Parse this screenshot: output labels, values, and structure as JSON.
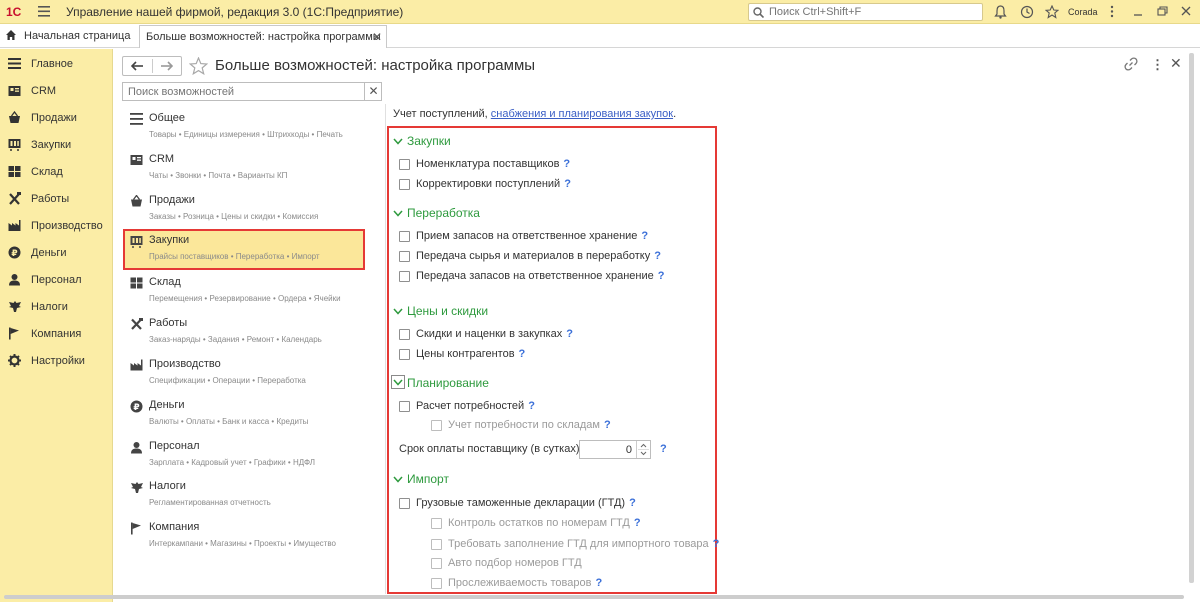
{
  "app": {
    "logo": "1С",
    "title": "Управление нашей фирмой, редакция 3.0  (1С:Предприятие)",
    "search_placeholder": "Поиск Ctrl+Shift+F",
    "user": "Corada"
  },
  "tabs": {
    "home": "Начальная страница",
    "active": "Больше возможностей: настройка программы"
  },
  "sidebar": {
    "items": [
      {
        "label": "Главное",
        "icon": "menu-lines-icon"
      },
      {
        "label": "CRM",
        "icon": "crm-icon"
      },
      {
        "label": "Продажи",
        "icon": "basket-icon"
      },
      {
        "label": "Закупки",
        "icon": "cart-icon"
      },
      {
        "label": "Склад",
        "icon": "warehouse-icon"
      },
      {
        "label": "Работы",
        "icon": "tools-icon"
      },
      {
        "label": "Производство",
        "icon": "factory-icon"
      },
      {
        "label": "Деньги",
        "icon": "coin-icon"
      },
      {
        "label": "Персонал",
        "icon": "person-icon"
      },
      {
        "label": "Налоги",
        "icon": "eagle-icon"
      },
      {
        "label": "Компания",
        "icon": "flag-icon"
      },
      {
        "label": "Настройки",
        "icon": "gear-icon"
      }
    ]
  },
  "form": {
    "title": "Больше возможностей: настройка программы",
    "search_placeholder": "Поиск возможностей"
  },
  "sections": [
    {
      "name": "Общее",
      "sub": "Товары • Единицы измерения • Штрихкоды • Печать",
      "icon": "lines-icon"
    },
    {
      "name": "CRM",
      "sub": "Чаты • Звонки • Почта • Варианты КП",
      "icon": "crm-icon"
    },
    {
      "name": "Продажи",
      "sub": "Заказы • Розница • Цены и скидки • Комиссия",
      "icon": "basket-icon"
    },
    {
      "name": "Закупки",
      "sub": "Прайсы поставщиков • Переработка • Импорт",
      "icon": "cart-icon"
    },
    {
      "name": "Склад",
      "sub": "Перемещения • Резервирование • Ордера • Ячейки",
      "icon": "warehouse-icon"
    },
    {
      "name": "Работы",
      "sub": "Заказ-наряды • Задания • Ремонт • Календарь",
      "icon": "tools-icon"
    },
    {
      "name": "Производство",
      "sub": "Спецификации • Операции • Переработка",
      "icon": "factory-icon"
    },
    {
      "name": "Деньги",
      "sub": "Валюты • Оплаты • Банк и касса • Кредиты",
      "icon": "coin-icon"
    },
    {
      "name": "Персонал",
      "sub": "Зарплата • Кадровый учет • Графики • НДФЛ",
      "icon": "person-icon"
    },
    {
      "name": "Налоги",
      "sub": "Регламентированная отчетность",
      "icon": "eagle-icon"
    },
    {
      "name": "Компания",
      "sub": "Интеркампани • Магазины • Проекты • Имущество",
      "icon": "flag-icon"
    }
  ],
  "active_section": "Закупки",
  "intro": {
    "text": "Учет поступлений, ",
    "link": "снабжения и планирования закупок",
    "tail": "."
  },
  "groups": {
    "purchases": {
      "title": "Закупки",
      "options": [
        "Номенклатура поставщиков",
        "Корректировки поступлений"
      ]
    },
    "processing": {
      "title": "Переработка",
      "options": [
        "Прием запасов на ответственное хранение",
        "Передача сырья и материалов в переработку",
        "Передача запасов на ответственное хранение"
      ]
    },
    "prices": {
      "title": "Цены и скидки",
      "options": [
        "Скидки и наценки в закупках",
        "Цены контрагентов"
      ]
    },
    "planning": {
      "title": "Планирование",
      "options": [
        "Расчет потребностей",
        "Учет потребности по складам"
      ],
      "term_label": "Срок оплаты поставщику (в сутках):",
      "term_value": "0"
    },
    "import": {
      "title": "Импорт",
      "options": [
        "Грузовые таможенные декларации (ГТД)",
        "Контроль остатков по номерам ГТД",
        "Требовать заполнение ГТД для импортного товара",
        "Авто подбор номеров ГТД",
        "Прослеживаемость товаров"
      ]
    }
  },
  "help_mark": "?",
  "colors": {
    "accent_yellow": "#fbeda6",
    "group_green": "#2e9a3e",
    "highlight_red": "#e53935",
    "link_blue": "#3a5ec5"
  }
}
